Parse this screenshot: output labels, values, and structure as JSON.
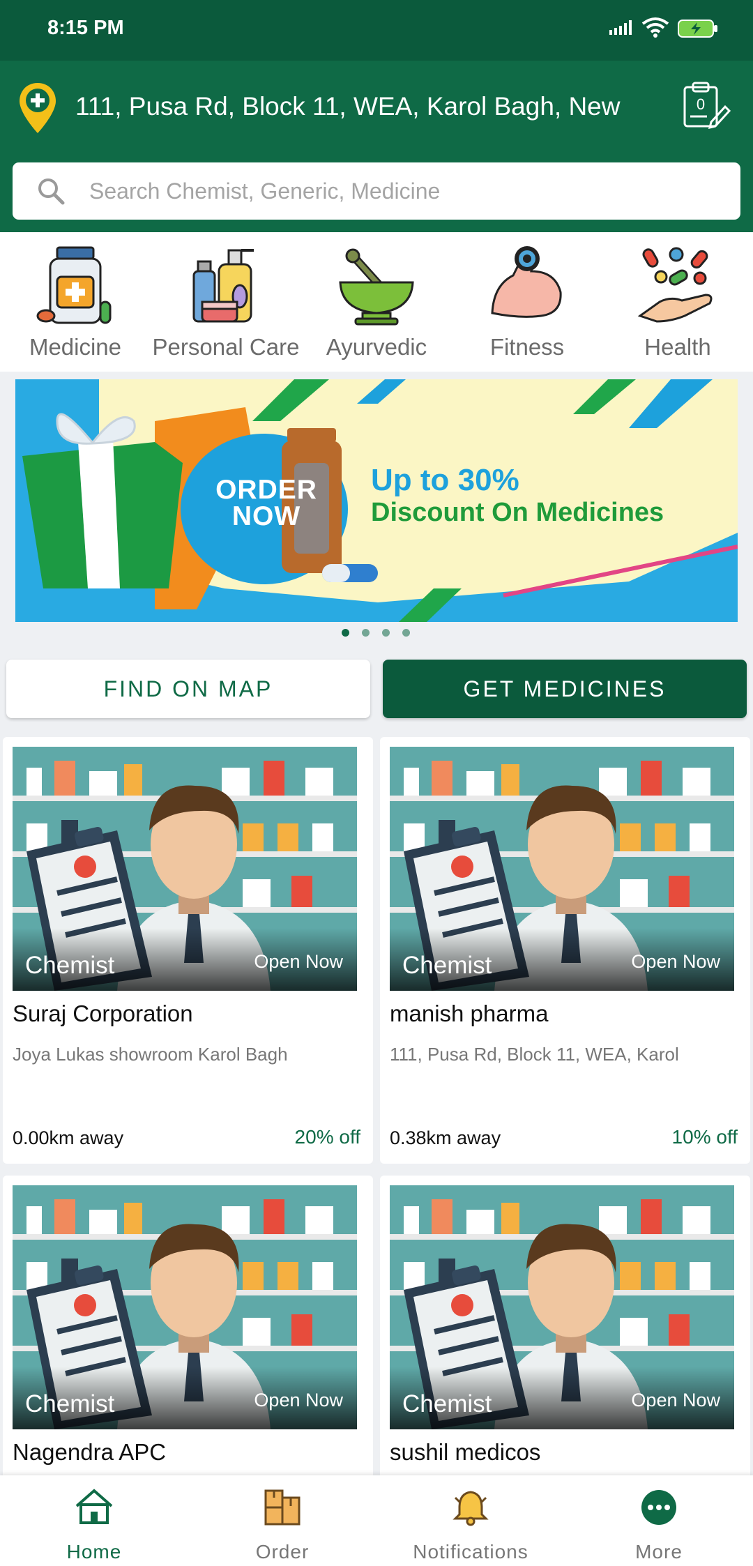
{
  "status_bar": {
    "time": "8:15 PM",
    "icons": [
      "signal-icon",
      "wifi-icon",
      "battery-charging-icon"
    ]
  },
  "header": {
    "address": "111, Pusa Rd, Block 11, WEA, Karol Bagh, New",
    "location_icon": "location-pin-icon",
    "prescription_icon": "prescription-upload-icon"
  },
  "search": {
    "placeholder": "Search Chemist, Generic, Medicine",
    "value": ""
  },
  "categories": [
    {
      "label": "Medicine",
      "icon": "medicine-bottle-icon"
    },
    {
      "label": "Personal Care",
      "icon": "personal-care-icon"
    },
    {
      "label": "Ayurvedic",
      "icon": "mortar-pestle-icon"
    },
    {
      "label": "Fitness",
      "icon": "bicep-icon"
    },
    {
      "label": "Health",
      "icon": "pills-hand-icon"
    }
  ],
  "banner": {
    "cta": "ORDER NOW",
    "headline": "Up to 30%",
    "subheadline": "Discount On Medicines",
    "slides": 4,
    "active_slide": 0
  },
  "actions": {
    "find_on_map": "FIND ON MAP",
    "get_medicines": "GET MEDICINES"
  },
  "stores": [
    {
      "type": "Chemist",
      "status": "Open Now",
      "name": "Suraj Corporation",
      "address": "Joya Lukas showroom Karol Bagh",
      "distance": "0.00km away",
      "discount": "20% off"
    },
    {
      "type": "Chemist",
      "status": "Open Now",
      "name": "manish pharma",
      "address": "111, Pusa Rd, Block 11, WEA, Karol",
      "distance": "0.38km away",
      "discount": "10% off"
    },
    {
      "type": "Chemist",
      "status": "Open Now",
      "name": "Nagendra APC",
      "address": "",
      "distance": "",
      "discount": ""
    },
    {
      "type": "Chemist",
      "status": "Open Now",
      "name": "sushil medicos",
      "address": "",
      "distance": "",
      "discount": ""
    }
  ],
  "nav": [
    {
      "label": "Home",
      "icon": "home-icon",
      "active": true
    },
    {
      "label": "Order",
      "icon": "order-box-icon",
      "active": false
    },
    {
      "label": "Notifications",
      "icon": "bell-icon",
      "active": false
    },
    {
      "label": "More",
      "icon": "more-icon",
      "active": false
    }
  ],
  "colors": {
    "primary": "#0f6a46",
    "primary_dark": "#0b5a3c",
    "background": "#eef0f3"
  }
}
